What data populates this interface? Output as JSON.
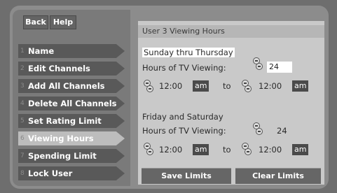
{
  "top_buttons": {
    "back": "Back",
    "help": "Help"
  },
  "sidebar": {
    "items": [
      {
        "num": "1",
        "label": "Name",
        "active": false
      },
      {
        "num": "2",
        "label": "Edit Channels",
        "active": false
      },
      {
        "num": "3",
        "label": "Add All Channels",
        "active": false
      },
      {
        "num": "4",
        "label": "Delete All Channels",
        "active": false
      },
      {
        "num": "5",
        "label": "Set Rating Limit",
        "active": false
      },
      {
        "num": "6",
        "label": "Viewing Hours",
        "active": true
      },
      {
        "num": "7",
        "label": "Spending Limit",
        "active": false
      },
      {
        "num": "8",
        "label": "Lock User",
        "active": false
      }
    ]
  },
  "panel": {
    "title": "User 3 Viewing Hours",
    "weekday": {
      "heading": "Sunday thru Thursday",
      "hours_label": "Hours of TV Viewing:",
      "hours_value": "24",
      "start_time": "12:00",
      "start_ampm": "am",
      "to": "to",
      "end_time": "12:00",
      "end_ampm": "am"
    },
    "weekend": {
      "heading": "Friday and Saturday",
      "hours_label": "Hours of TV Viewing:",
      "hours_value": "24",
      "start_time": "12:00",
      "start_ampm": "am",
      "to": "to",
      "end_time": "12:00",
      "end_ampm": "am"
    },
    "buttons": {
      "save": "Save Limits",
      "clear": "Clear Limits"
    }
  }
}
